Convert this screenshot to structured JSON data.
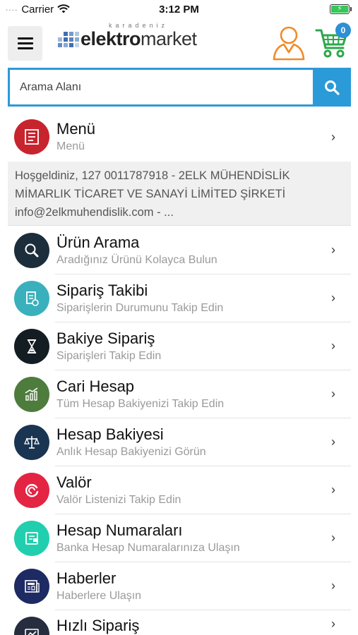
{
  "status_bar": {
    "dots": "....",
    "carrier": "Carrier",
    "time": "3:12 PM"
  },
  "header": {
    "logo_sub": "karadeniz",
    "logo_bold": "elektro",
    "logo_rest": "market",
    "cart_count": "0"
  },
  "search": {
    "placeholder": "Arama Alanı"
  },
  "menu_section": {
    "title": "Menü",
    "subtitle": "Menü",
    "color": "#c8242d"
  },
  "welcome": {
    "line1": "Hoşgeldiniz, 127 0011787918 - 2ELK MÜHENDİSLİK",
    "line2": "MİMARLIK TİCARET VE SANAYİ LİMİTED ŞİRKETİ",
    "line3": "info@2elkmuhendislik.com - ..."
  },
  "items": [
    {
      "title": "Ürün Arama",
      "subtitle": "Aradığınız Ürünü Kolayca Bulun",
      "icon": "search-icon",
      "color": "#1c2e3b"
    },
    {
      "title": "Sipariş Takibi",
      "subtitle": "Siparişlerin Durumunu Takip Edin",
      "icon": "order-tracking-icon",
      "color": "#3ab0bc"
    },
    {
      "title": "Bakiye Sipariş",
      "subtitle": "Siparişleri Takip Edin",
      "icon": "hourglass-icon",
      "color": "#141d22"
    },
    {
      "title": "Cari Hesap",
      "subtitle": "Tüm Hesap Bakiyenizi Takip Edin",
      "icon": "chart-icon",
      "color": "#4d7c3c"
    },
    {
      "title": "Hesap Bakiyesi",
      "subtitle": "Anlık Hesap Bakiyenizi Görün",
      "icon": "scale-icon",
      "color": "#1a3552"
    },
    {
      "title": "Valör",
      "subtitle": "Valör Listenizi Takip Edin",
      "icon": "refresh-icon",
      "color": "#e32443"
    },
    {
      "title": "Hesap Numaraları",
      "subtitle": "Banka Hesap Numaralarınıza Ulaşın",
      "icon": "bank-account-icon",
      "color": "#21cfae"
    },
    {
      "title": "Haberler",
      "subtitle": "Haberlere Ulaşın",
      "icon": "news-icon",
      "color": "#1e2a63"
    },
    {
      "title": "Hızlı Sipariş",
      "subtitle": "",
      "icon": "quick-order-icon",
      "color": "#252d3e"
    }
  ]
}
